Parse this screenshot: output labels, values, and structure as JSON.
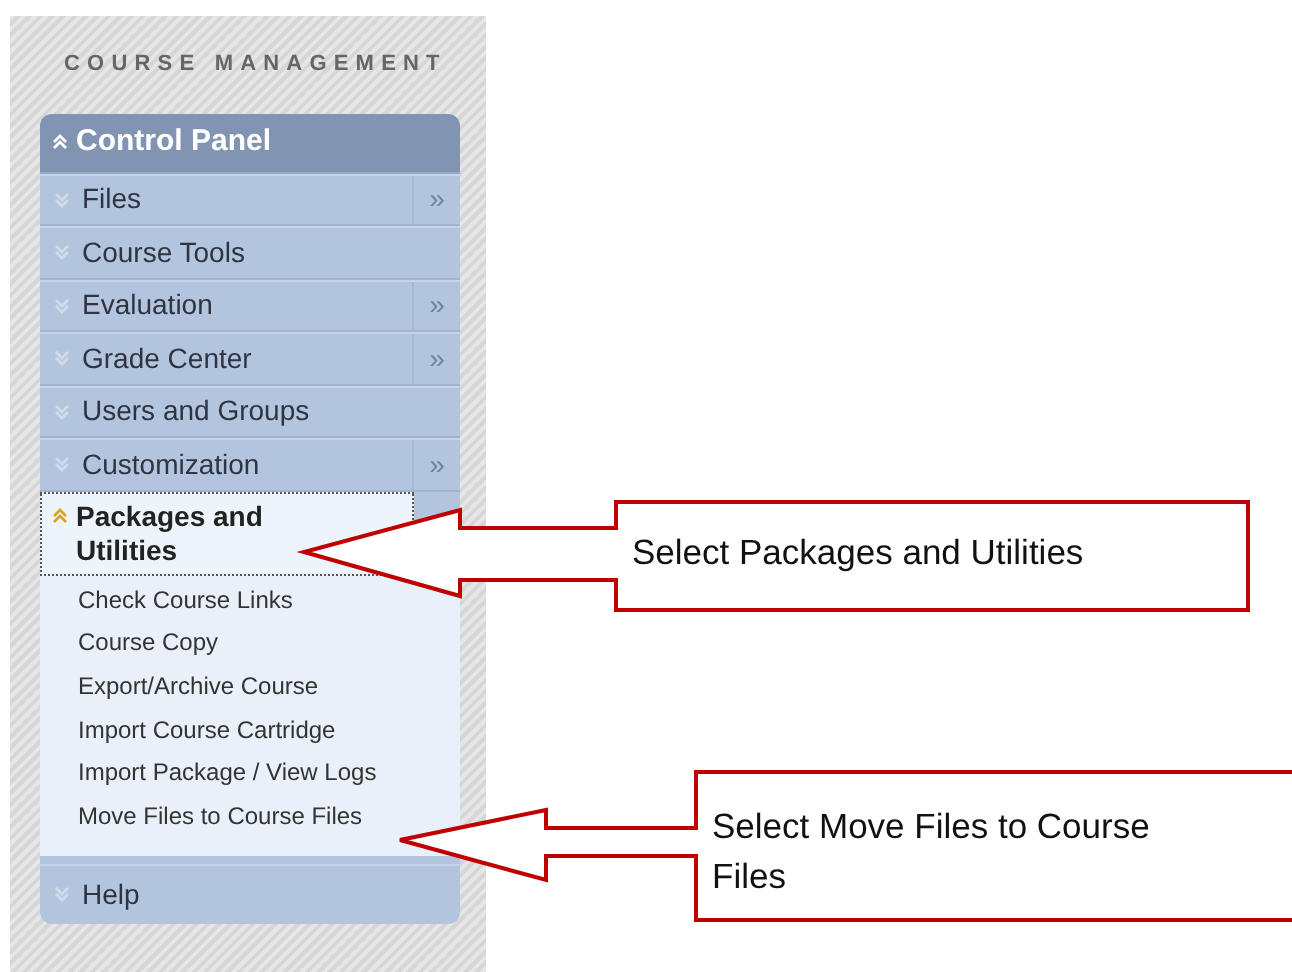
{
  "heading": "COURSE MANAGEMENT",
  "panel": {
    "title": "Control Panel",
    "expanded": true
  },
  "sections": [
    {
      "label": "Files",
      "expanded": false,
      "selected": false,
      "arrow": "»"
    },
    {
      "label": "Course Tools",
      "expanded": false,
      "selected": false
    },
    {
      "label": "Evaluation",
      "expanded": false,
      "selected": false,
      "arrow": "»"
    },
    {
      "label": "Grade Center",
      "expanded": false,
      "selected": false,
      "arrow": "»"
    },
    {
      "label": "Users and Groups",
      "expanded": false,
      "selected": false
    },
    {
      "label": "Customization",
      "expanded": false,
      "selected": false,
      "arrow": "»"
    },
    {
      "label": "Packages and Utilities",
      "expanded": true,
      "selected": true,
      "children": [
        {
          "label": "Check Course Links"
        },
        {
          "label": "Course Copy"
        },
        {
          "label": "Export/Archive Course"
        },
        {
          "label": "Import Course Cartridge"
        },
        {
          "label": "Import Package / View Logs"
        },
        {
          "label": "Move Files to Course Files"
        }
      ]
    },
    {
      "label": "Help",
      "expanded": false,
      "selected": false
    }
  ],
  "callouts": [
    {
      "text": "Select Packages and Utilities"
    },
    {
      "text": "Select Move Files to Course Files"
    }
  ]
}
